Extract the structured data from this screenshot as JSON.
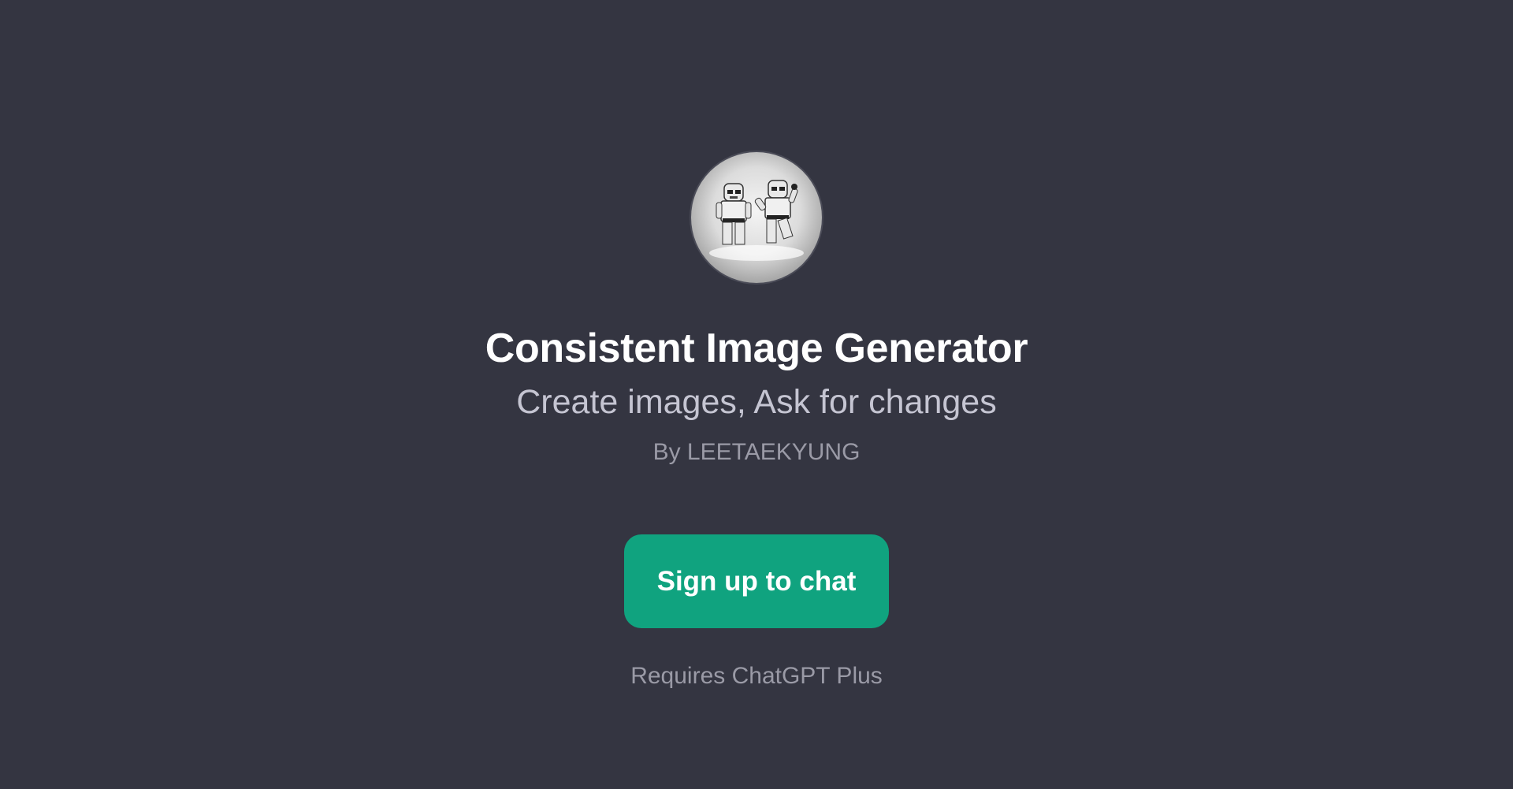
{
  "gpt": {
    "avatar_icon": "stormtrooper-minifigures-avatar",
    "title": "Consistent Image Generator",
    "description": "Create images, Ask for changes",
    "author": "By LEETAEKYUNG"
  },
  "actions": {
    "signup_label": "Sign up to chat"
  },
  "footer": {
    "requirement": "Requires ChatGPT Plus"
  },
  "colors": {
    "background": "#343541",
    "accent": "#10a37f",
    "title": "#ffffff",
    "subtitle": "#c5c5d2",
    "muted": "#9a9aa6"
  }
}
